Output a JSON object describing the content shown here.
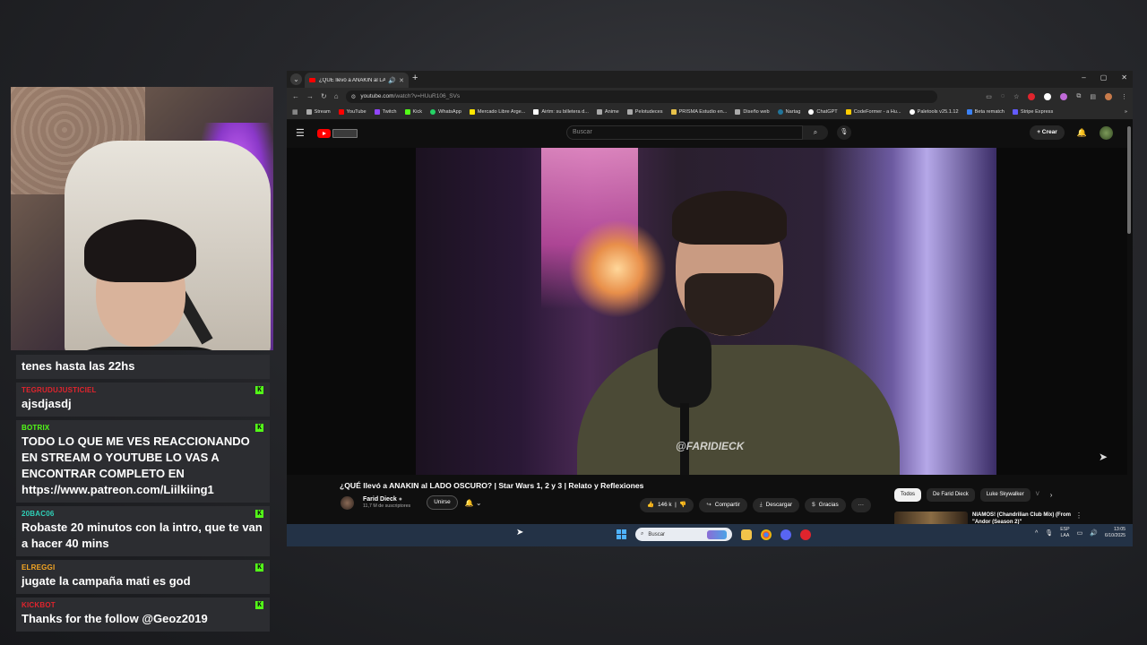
{
  "colors": {
    "youtube_red": "#ff0000",
    "kick_green": "#53fc18",
    "chat_bg": "#2c2d31",
    "taskbar_bg": "#233246"
  },
  "browser": {
    "tab_title": "¿QUÉ llevó a ANAKIN al LAD",
    "tab_icons": {
      "audio": "speaker-icon",
      "close": "✕"
    },
    "new_tab": "+",
    "window_controls": {
      "minimize": "–",
      "maximize": "▢",
      "close": "✕"
    },
    "url_host": "youtube.com",
    "url_path": "/watch?v=HUuR106_SVs",
    "bookmarks": [
      {
        "label": "Stream",
        "color": "#aaaaaa"
      },
      {
        "label": "YouTube",
        "color": "#ff0000"
      },
      {
        "label": "Twitch",
        "color": "#9146ff"
      },
      {
        "label": "Kick",
        "color": "#53fc18"
      },
      {
        "label": "WhatsApp",
        "color": "#25d366"
      },
      {
        "label": "Mercado Libre Arge...",
        "color": "#ffe600"
      },
      {
        "label": "Airtm: su billetera d...",
        "color": "#ffffff"
      },
      {
        "label": "Anime",
        "color": "#aaaaaa"
      },
      {
        "label": "Pelotudeces",
        "color": "#aaaaaa"
      },
      {
        "label": "PRISMA Estudio en...",
        "color": "#e8c24a"
      },
      {
        "label": "Diseño web",
        "color": "#aaaaaa"
      },
      {
        "label": "Nartag",
        "color": "#21759b"
      },
      {
        "label": "ChatGPT",
        "color": "#ffffff"
      },
      {
        "label": "CodeFormer - a Hu...",
        "color": "#ffcc00"
      },
      {
        "label": "Paletools v25.1.12",
        "color": "#ffffff"
      },
      {
        "label": "Beta rematch",
        "color": "#3b82f6"
      },
      {
        "label": "Stripe Express",
        "color": "#635bff"
      }
    ],
    "more_bookmarks": "»"
  },
  "youtube": {
    "search_placeholder": "Buscar",
    "create_label": "Crear",
    "video_title": "¿QUÉ llevó a ANAKIN al LADO OSCURO? | Star Wars 1, 2 y 3 | Relato y Reflexiones",
    "watermark": "@FARIDIECK",
    "channel_name": "Farid Dieck",
    "channel_subs": "11,7 M de suscriptores",
    "join_label": "Unirse",
    "like_count": "146 k",
    "share_label": "Compartir",
    "download_label": "Descargar",
    "thanks_label": "Gracias",
    "more_label": "···",
    "chips": [
      "Todos",
      "De Farid Dieck",
      "Luke Skywalker",
      "V"
    ],
    "reco_title": "NIAMOS! (Chandrilian Club Mix) (From \"Andor (Season 2)\""
  },
  "taskbar": {
    "search_label": "Buscar",
    "lang_top": "ESP",
    "lang_bottom": "LAA",
    "time": "13:05",
    "date": "6/10/2025"
  },
  "chat": [
    {
      "user": "",
      "user_color": "#ffffff",
      "text": "tenes hasta las 22hs",
      "kick": false
    },
    {
      "user": "TEGRUDUJUSTICIEL",
      "user_color": "#e0242d",
      "text": "ajsdjasdj",
      "kick": true
    },
    {
      "user": "BOTRIX",
      "user_color": "#53fc18",
      "text": "TODO LO QUE ME VES REACCIONANDO EN STREAM O YOUTUBE LO VAS A ENCONTRAR COMPLETO EN https://www.patreon.com/Liilkiing1",
      "kick": true
    },
    {
      "user": "20BAC06",
      "user_color": "#2fd0b8",
      "text": "Robaste 20 minutos con la intro, que te van a hacer 40 mins",
      "kick": true
    },
    {
      "user": "ELREGGI",
      "user_color": "#f5a623",
      "text": "jugate la campaña mati es god",
      "kick": true
    },
    {
      "user": "KICKBOT",
      "user_color": "#e0242d",
      "text": "Thanks for the follow @Geoz2019",
      "kick": true
    }
  ]
}
